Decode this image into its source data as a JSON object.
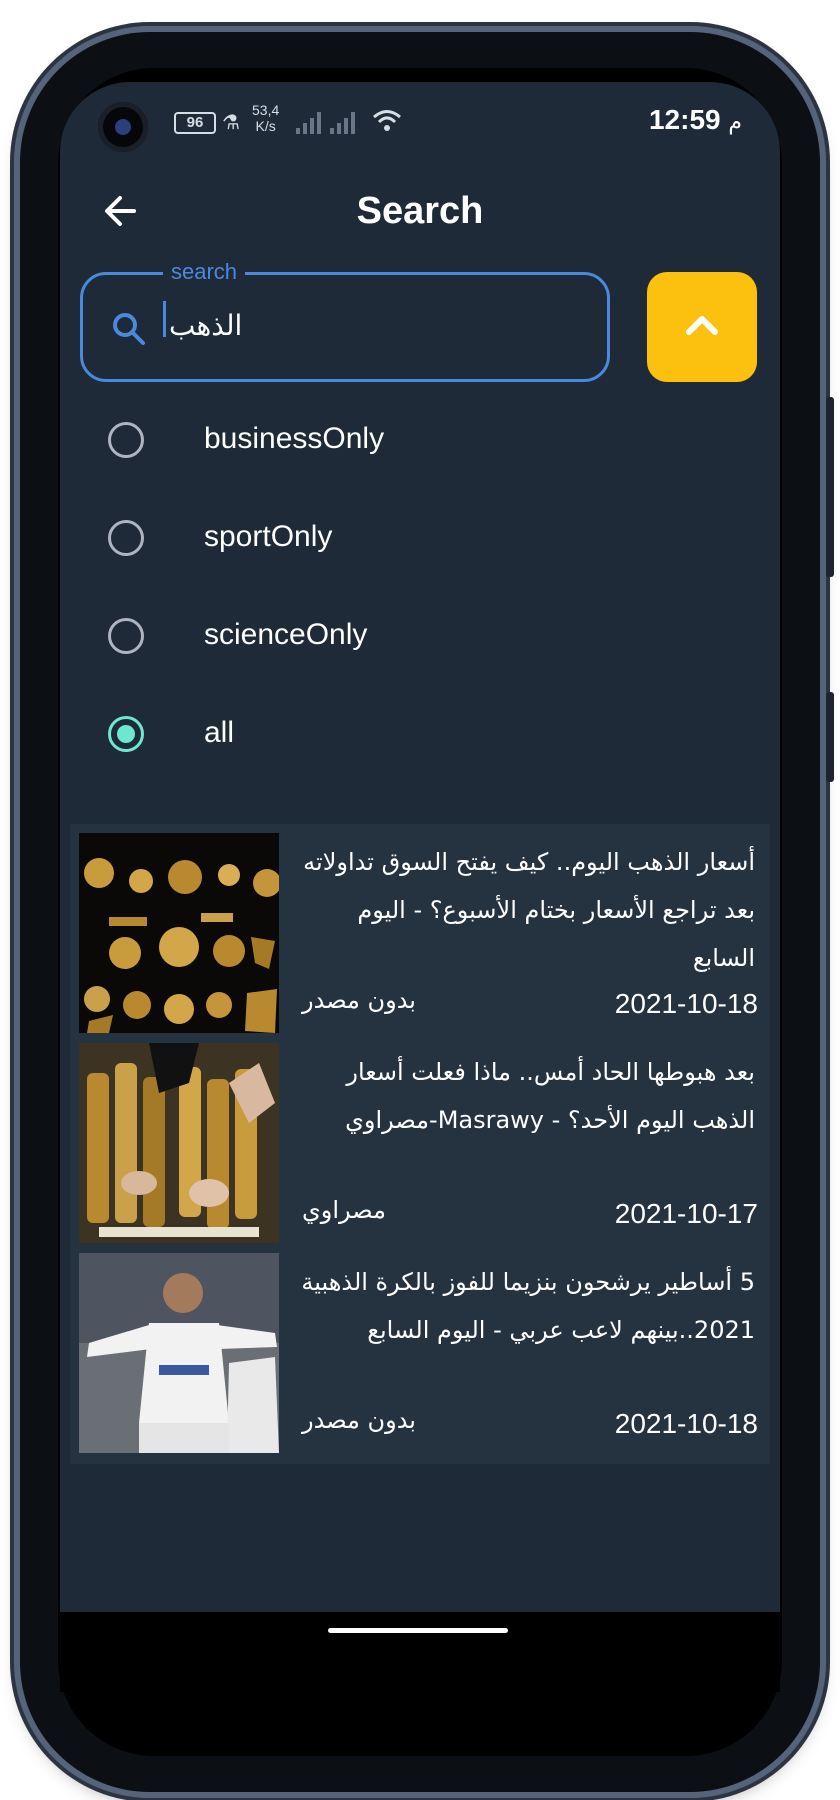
{
  "status_bar": {
    "battery": "96",
    "net_speed_value": "53,4",
    "net_speed_unit": "K/s",
    "time": "12:59",
    "time_suffix": "م"
  },
  "app_bar": {
    "title": "Search"
  },
  "search": {
    "label": "search",
    "value": "الذهب"
  },
  "filters": {
    "selected": "all",
    "options": [
      "businessOnly",
      "sportOnly",
      "scienceOnly",
      "all"
    ]
  },
  "articles": [
    {
      "title": "أسعار الذهب اليوم.. كيف يفتح السوق تداولاته بعد تراجع الأسعار بختام الأسبوع؟ - اليوم السابع",
      "source": "بدون مصدر",
      "date": "2021-10-18",
      "thumbnail": "gold-coins"
    },
    {
      "title": "بعد هبوطها الحاد أمس.. ماذا فعلت أسعار الذهب اليوم الأحد؟ - Masrawy-مصراوي",
      "source": "مصراوي",
      "date": "2021-10-17",
      "thumbnail": "gold-bracelets"
    },
    {
      "title": "5 أساطير يرشحون بنزيما للفوز بالكرة الذهبية 2021..بينهم لاعب عربي - اليوم السابع",
      "source": "بدون مصدر",
      "date": "2021-10-18",
      "thumbnail": "football-player"
    }
  ],
  "colors": {
    "background": "#1e2a38",
    "card": "#25323f",
    "accent_blue": "#4a89dc",
    "accent_yellow": "#fcc10f",
    "radio_selected": "#6ee7cf"
  }
}
